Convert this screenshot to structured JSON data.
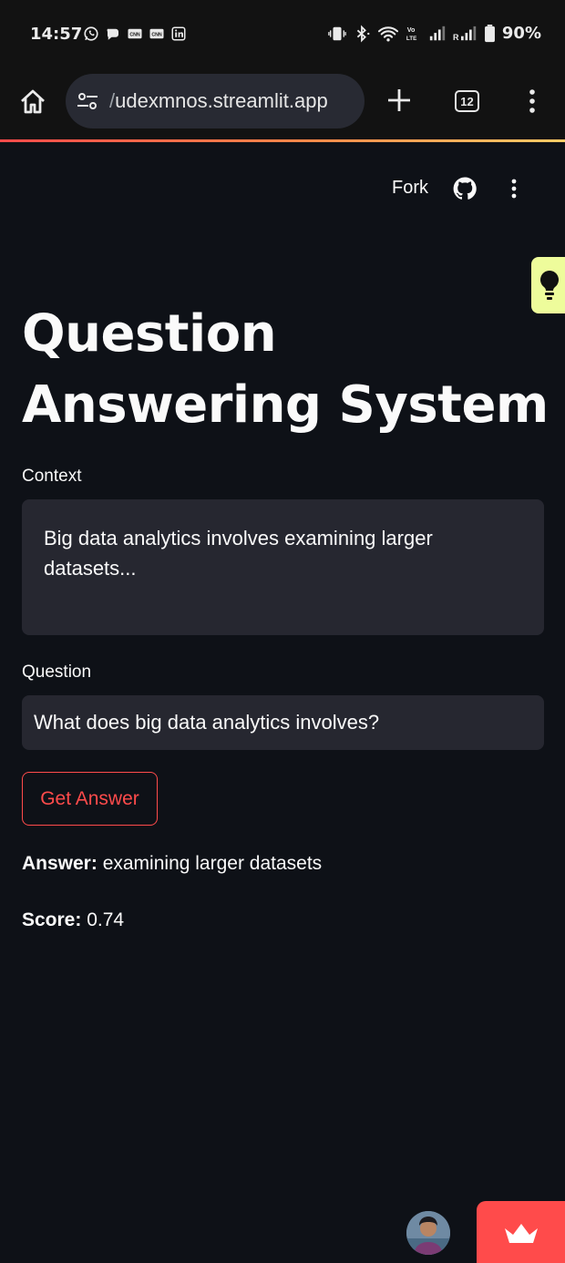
{
  "status_bar": {
    "time": "14:57",
    "battery": "90%",
    "left_icons": [
      "whatsapp-icon",
      "chat-bubble-icon",
      "cnn-icon",
      "cnn-icon",
      "linkedin-icon"
    ],
    "right_icons": [
      "vibrate-icon",
      "bluetooth-icon",
      "wifi-icon",
      "volte-icon",
      "signal-icon",
      "signal-roaming-icon",
      "battery-icon"
    ],
    "volte_label": "Vo LTE",
    "roaming_label": "R"
  },
  "browser": {
    "url_prefix": "/",
    "url_text": "udexmnos.streamlit.app",
    "tab_count": "12",
    "icons": {
      "home": "home-icon",
      "site_settings": "tune-icon",
      "new_tab": "plus-icon",
      "menu": "more-vert-icon"
    }
  },
  "app_header": {
    "fork_label": "Fork",
    "github_icon": "github-icon",
    "menu_icon": "more-vert-icon"
  },
  "tip_tab": {
    "icon": "lightbulb-icon",
    "color": "#eefc9b"
  },
  "main": {
    "title_line1": "Question",
    "title_line2": "Answering System",
    "context_label": "Context",
    "context_value": "Big data analytics involves examining larger datasets...",
    "question_label": "Question",
    "question_value": "What does big data analytics involves?",
    "button_label": "Get Answer",
    "answer_label": "Answer:",
    "answer_value": "examining larger datasets",
    "score_label": "Score:",
    "score_value": "0.74"
  },
  "colors": {
    "background": "#0e1117",
    "input_bg": "#262730",
    "accent": "#ff4b4b",
    "text": "#fafafa"
  },
  "footer": {
    "avatar_icon": "user-avatar",
    "badge_icon": "streamlit-crown-icon"
  }
}
